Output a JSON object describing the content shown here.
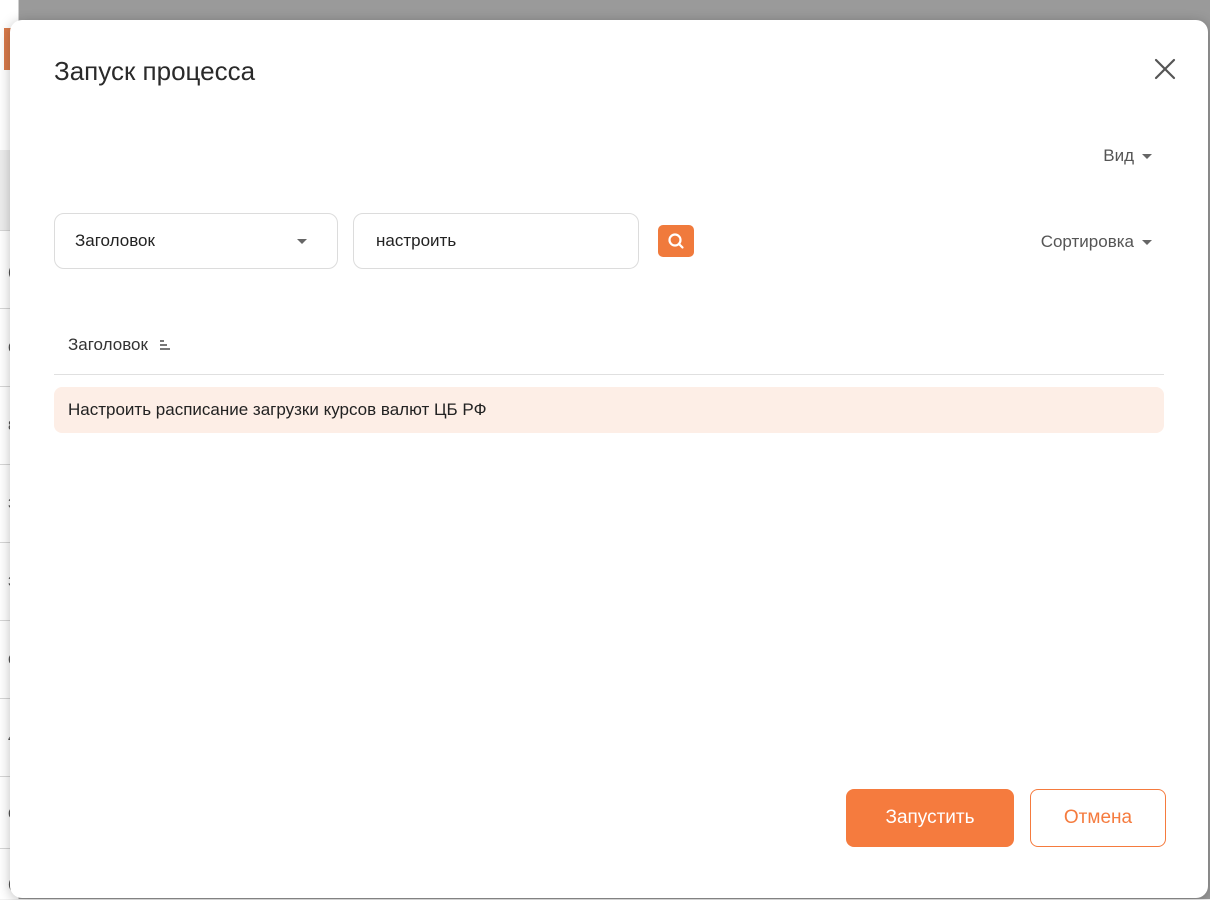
{
  "background": {
    "row_fragments": [
      "(",
      "(",
      "6",
      "8",
      "3",
      "3",
      "6",
      "4",
      "6",
      "("
    ]
  },
  "dialog": {
    "title": "Запуск процесса",
    "close_icon": "close-icon",
    "view_menu_label": "Вид",
    "filter": {
      "field_value": "Заголовок",
      "search_value": "настроить",
      "search_icon": "search-icon"
    },
    "sort_menu_label": "Сортировка",
    "table": {
      "column_header": "Заголовок",
      "sort_icon": "sort-ascending-icon",
      "rows": [
        {
          "title": "Настроить расписание загрузки курсов валют ЦБ РФ"
        }
      ]
    },
    "buttons": {
      "start_label": "Запустить",
      "cancel_label": "Отмена"
    }
  },
  "colors": {
    "accent": "#f57b3e",
    "selected_row": "#fdeee6"
  }
}
